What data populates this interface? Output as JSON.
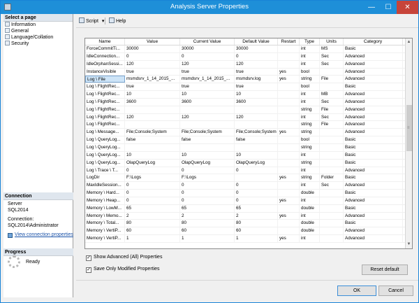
{
  "window": {
    "title": "Analysis Server Properties",
    "minimize_glyph": "—",
    "maximize_glyph": "☐",
    "close_glyph": "✕"
  },
  "left": {
    "select_page_header": "Select a page",
    "pages": [
      "Information",
      "General",
      "Language/Collation",
      "Security"
    ],
    "connection_header": "Connection",
    "server_label": "Server",
    "server_value": "SQL2014",
    "connection_label": "Connection:",
    "connection_value": "SQL2014\\Administrator",
    "view_link": "View connection properties",
    "progress_header": "Progress",
    "progress_status": "Ready"
  },
  "toolbar": {
    "script_label": "Script",
    "script_arrow": "▾",
    "help_label": "Help"
  },
  "grid": {
    "columns": [
      "Name",
      "Value",
      "Current Value",
      "Default Value",
      "Restart",
      "Type",
      "Units",
      "Category"
    ],
    "rows": [
      [
        "ForceCommitTi...",
        "30000",
        "30000",
        "30000",
        "",
        "int",
        "MS",
        "Basic"
      ],
      [
        "IdleConnection...",
        "0",
        "0",
        "0",
        "",
        "int",
        "Sec",
        "Advanced"
      ],
      [
        "IdleOrphanSessi...",
        "120",
        "120",
        "120",
        "",
        "int",
        "Sec",
        "Advanced"
      ],
      [
        "InstanceVisible",
        "true",
        "true",
        "true",
        "yes",
        "bool",
        "",
        "Advanced"
      ],
      [
        "Log \\ File",
        "msmdsrv_1_14_2015_...",
        "msmdsrv_1_14_2015_...",
        "msmdsrv.log",
        "yes",
        "string",
        "File",
        "Advanced"
      ],
      [
        "Log \\ FlightRec...",
        "true",
        "true",
        "true",
        "",
        "bool",
        "",
        "Basic"
      ],
      [
        "Log \\ FlightRec...",
        "10",
        "10",
        "10",
        "",
        "int",
        "MB",
        "Advanced"
      ],
      [
        "Log \\ FlightRec...",
        "3600",
        "3600",
        "3600",
        "",
        "int",
        "Sec",
        "Advanced"
      ],
      [
        "Log \\ FlightRec...",
        "",
        "",
        "",
        "",
        "string",
        "File",
        "Advanced"
      ],
      [
        "Log \\ FlightRec...",
        "120",
        "120",
        "120",
        "",
        "int",
        "Sec",
        "Advanced"
      ],
      [
        "Log \\ FlightRec...",
        "",
        "",
        "",
        "",
        "string",
        "File",
        "Advanced"
      ],
      [
        "Log \\ Message...",
        "File;Console;System",
        "File;Console;System",
        "File;Console;System",
        "yes",
        "string",
        "",
        "Advanced"
      ],
      [
        "Log \\ QueryLog...",
        "false",
        "false",
        "false",
        "",
        "bool",
        "",
        "Basic"
      ],
      [
        "Log \\ QueryLog...",
        "",
        "",
        "",
        "",
        "string",
        "",
        "Basic"
      ],
      [
        "Log \\ QueryLog...",
        "10",
        "10",
        "10",
        "",
        "int",
        "",
        "Basic"
      ],
      [
        "Log \\ QueryLog...",
        "OlapQueryLog",
        "OlapQueryLog",
        "OlapQueryLog",
        "",
        "string",
        "",
        "Basic"
      ],
      [
        "Log \\ Trace \\ T...",
        "0",
        "0",
        "0",
        "",
        "int",
        "",
        "Advanced"
      ],
      [
        "LogDir",
        "F:\\Logs",
        "F:\\Logs",
        "",
        "yes",
        "string",
        "Folder",
        "Basic"
      ],
      [
        "MaxIdleSession...",
        "0",
        "0",
        "0",
        "",
        "int",
        "Sec",
        "Advanced"
      ],
      [
        "Memory \\ Hard...",
        "0",
        "0",
        "0",
        "",
        "double",
        "",
        "Basic"
      ],
      [
        "Memory \\ Heap...",
        "0",
        "0",
        "0",
        "yes",
        "int",
        "",
        "Advanced"
      ],
      [
        "Memory \\ LowM...",
        "65",
        "65",
        "65",
        "",
        "double",
        "",
        "Basic"
      ],
      [
        "Memory \\ Memo...",
        "2",
        "2",
        "2",
        "yes",
        "int",
        "",
        "Advanced"
      ],
      [
        "Memory \\ Total...",
        "80",
        "80",
        "80",
        "",
        "double",
        "",
        "Basic"
      ],
      [
        "Memory \\ VertiP...",
        "60",
        "60",
        "60",
        "",
        "double",
        "",
        "Advanced"
      ],
      [
        "Memory \\ VertiP...",
        "1",
        "1",
        "1",
        "yes",
        "int",
        "",
        "Advanced"
      ]
    ],
    "selected_row": 4
  },
  "options": {
    "show_advanced_label": "Show Advanced (All) Properties",
    "show_advanced_checked": true,
    "save_modified_label": "Save Only Modified Properties",
    "save_modified_checked": true,
    "check_glyph": "✓"
  },
  "buttons": {
    "reset_default": "Reset default",
    "ok": "OK",
    "cancel": "Cancel"
  },
  "scroll": {
    "up_glyph": "▲",
    "down_glyph": "▼",
    "grip_glyph": "≡"
  },
  "colors": {
    "accent": "#1e8fd8",
    "close_button": "#c7443a",
    "selection": "#cde4f7",
    "link": "#1a52a8"
  }
}
